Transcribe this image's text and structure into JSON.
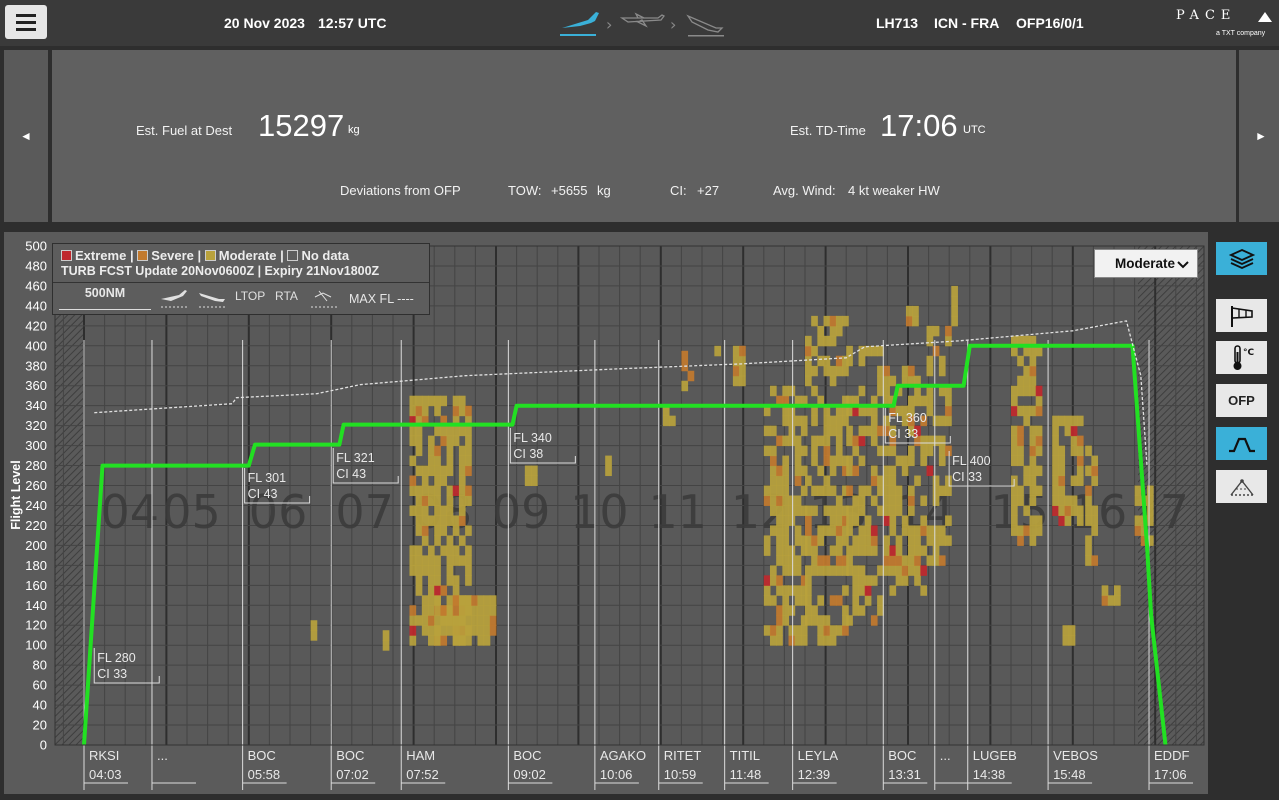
{
  "header": {
    "date": "20 Nov 2023",
    "time": "12:57 UTC",
    "flight": "LH713",
    "route": "ICN - FRA",
    "ofp": "OFP16/0/1",
    "logo_main": "PACE",
    "logo_sub": "a TXT company"
  },
  "summary": {
    "fuel_label": "Est. Fuel at Dest",
    "fuel_value": "15297",
    "fuel_unit": "kg",
    "td_label": "Est. TD-Time",
    "td_value": "17:06",
    "td_unit": "UTC",
    "deviations_label": "Deviations from OFP",
    "tow_label": "TOW:",
    "tow_value": "+5655",
    "tow_unit": "kg",
    "ci_label": "CI:",
    "ci_value": "+27",
    "wind_label": "Avg. Wind:",
    "wind_value": "4 kt weaker HW",
    "nav_left": "◄",
    "nav_right": "►"
  },
  "legend": {
    "extreme": "Extreme",
    "severe": "Severe",
    "moderate": "Moderate",
    "nodata": "No data",
    "separator": "|",
    "forecast": "TURB FCST Update 20Nov0600Z | Expiry 21Nov1800Z",
    "scale": "500NM",
    "ltop": "LTOP",
    "rta": "RTA",
    "maxfl": "MAX FL ----",
    "colors": {
      "extreme": "#c0282d",
      "severe": "#c27a2e",
      "moderate": "#b9a23c",
      "nodata": "#5a5a5a"
    }
  },
  "severity_select": {
    "value": "Moderate"
  },
  "side_toolbar": {
    "ofp_label": "OFP",
    "temp_label": "°C"
  },
  "chart_data": {
    "type": "line",
    "ylabel": "Flight Level",
    "ylim": [
      0,
      500
    ],
    "yticks": [
      0,
      20,
      40,
      60,
      80,
      100,
      120,
      140,
      160,
      180,
      200,
      220,
      240,
      260,
      280,
      300,
      320,
      340,
      360,
      380,
      400,
      420,
      440,
      460,
      480,
      500
    ],
    "hour_labels": [
      "04",
      "05",
      "06",
      "07",
      "08",
      "09",
      "10",
      "11",
      "12",
      "13",
      "14",
      "15",
      "16",
      "17"
    ],
    "waypoints": [
      {
        "name": "RKSI",
        "time": "04:03"
      },
      {
        "name": "...",
        "time": ""
      },
      {
        "name": "BOC",
        "time": "05:58"
      },
      {
        "name": "BOC",
        "time": "07:02"
      },
      {
        "name": "HAM",
        "time": "07:52"
      },
      {
        "name": "BOC",
        "time": "09:02"
      },
      {
        "name": "AGAKO",
        "time": "10:06"
      },
      {
        "name": "RITET",
        "time": "10:59"
      },
      {
        "name": "TITIL",
        "time": "11:48"
      },
      {
        "name": "LEYLA",
        "time": "12:39"
      },
      {
        "name": "BOC",
        "time": "13:31"
      },
      {
        "name": "...",
        "time": ""
      },
      {
        "name": "LUGEB",
        "time": "14:38"
      },
      {
        "name": "VEBOS",
        "time": "15:48"
      },
      {
        "name": "EDDF",
        "time": "17:06"
      }
    ],
    "step_labels": [
      {
        "fl": "FL 280",
        "ci": "CI 33"
      },
      {
        "fl": "FL 301",
        "ci": "CI 43"
      },
      {
        "fl": "FL 321",
        "ci": "CI 43"
      },
      {
        "fl": "FL 340",
        "ci": "CI 38"
      },
      {
        "fl": "FL 360",
        "ci": "CI 33"
      },
      {
        "fl": "FL 400",
        "ci": "CI 33"
      }
    ],
    "series": [
      {
        "name": "Flight Level",
        "color": "#22e022",
        "points": [
          [
            0,
            0
          ],
          [
            0.9,
            280
          ],
          [
            8.0,
            280
          ],
          [
            8.3,
            301
          ],
          [
            12.4,
            301
          ],
          [
            12.6,
            321
          ],
          [
            20.8,
            321
          ],
          [
            21.0,
            340
          ],
          [
            39.3,
            340
          ],
          [
            39.5,
            360
          ],
          [
            42.7,
            360
          ],
          [
            43.0,
            400
          ],
          [
            50.9,
            400
          ],
          [
            51.6,
            200
          ],
          [
            51.8,
            130
          ],
          [
            52.5,
            0
          ]
        ]
      },
      {
        "name": "MAX FL",
        "color": "#e0e0e0",
        "points": [
          [
            0.5,
            333
          ],
          [
            7.2,
            342
          ],
          [
            7.4,
            348
          ],
          [
            11.3,
            352
          ],
          [
            13.4,
            361
          ],
          [
            18.5,
            370
          ],
          [
            26.0,
            377
          ],
          [
            32.0,
            382
          ],
          [
            37.0,
            388
          ],
          [
            37.9,
            399
          ],
          [
            42.5,
            405
          ],
          [
            48.0,
            415
          ],
          [
            50.6,
            425
          ],
          [
            51.3,
            370
          ],
          [
            51.6,
            280
          ]
        ]
      }
    ]
  }
}
